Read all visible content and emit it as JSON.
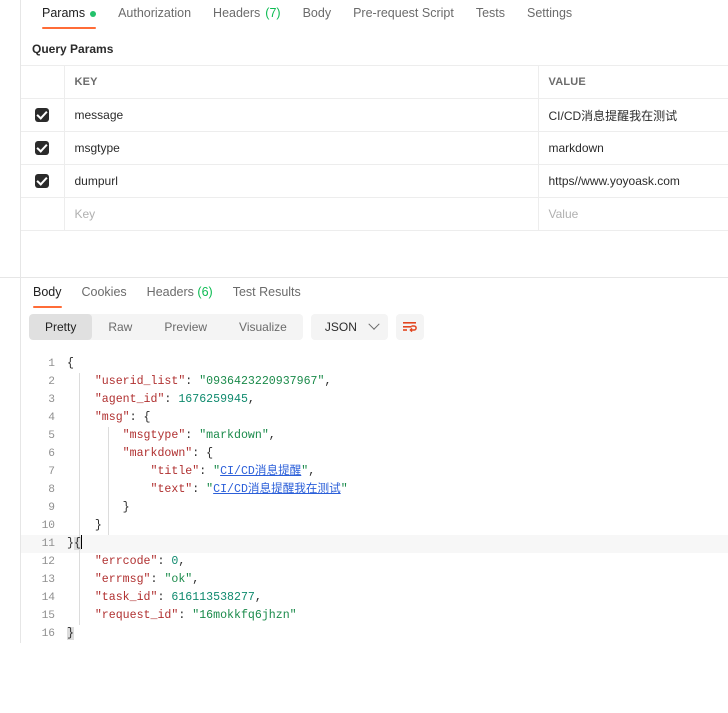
{
  "request": {
    "tabs": [
      {
        "label": "Params",
        "active": true,
        "indicator": "dot"
      },
      {
        "label": "Authorization",
        "active": false,
        "indicator": "none"
      },
      {
        "label": "Headers",
        "active": false,
        "indicator": "count",
        "count": "(7)"
      },
      {
        "label": "Body",
        "active": false,
        "indicator": "none"
      },
      {
        "label": "Pre-request Script",
        "active": false,
        "indicator": "none"
      },
      {
        "label": "Tests",
        "active": false,
        "indicator": "none"
      },
      {
        "label": "Settings",
        "active": false,
        "indicator": "none"
      }
    ],
    "section_title": "Query Params",
    "table": {
      "headers": {
        "key": "KEY",
        "value": "VALUE"
      },
      "rows": [
        {
          "checked": true,
          "key": "message",
          "value": "CI/CD消息提醒我在测试",
          "placeholder": false
        },
        {
          "checked": true,
          "key": "msgtype",
          "value": "markdown",
          "placeholder": false
        },
        {
          "checked": true,
          "key": "dumpurl",
          "value": "https//www.yoyoask.com",
          "placeholder": false
        },
        {
          "checked": false,
          "key": "Key",
          "value": "Value",
          "placeholder": true
        }
      ]
    }
  },
  "response": {
    "tabs": [
      {
        "label": "Body",
        "active": true,
        "indicator": "none"
      },
      {
        "label": "Cookies",
        "active": false,
        "indicator": "none"
      },
      {
        "label": "Headers",
        "active": false,
        "indicator": "count",
        "count": "(6)"
      },
      {
        "label": "Test Results",
        "active": false,
        "indicator": "none"
      }
    ],
    "view_modes": [
      {
        "label": "Pretty",
        "active": true
      },
      {
        "label": "Raw",
        "active": false
      },
      {
        "label": "Preview",
        "active": false
      },
      {
        "label": "Visualize",
        "active": false
      }
    ],
    "format": "JSON",
    "wrap_icon": "word-wrap-icon",
    "body_lines": [
      {
        "no": "1",
        "text": "{"
      },
      {
        "no": "2",
        "text": "    \"userid_list\": \"0936423220937967\","
      },
      {
        "no": "3",
        "text": "    \"agent_id\": 1676259945,"
      },
      {
        "no": "4",
        "text": "    \"msg\": {"
      },
      {
        "no": "5",
        "text": "        \"msgtype\": \"markdown\","
      },
      {
        "no": "6",
        "text": "        \"markdown\": {"
      },
      {
        "no": "7",
        "text": "            \"title\": \"CI/CD消息提醒\","
      },
      {
        "no": "8",
        "text": "            \"text\": \"CI/CD消息提醒我在测试\""
      },
      {
        "no": "9",
        "text": "        }"
      },
      {
        "no": "10",
        "text": "    }"
      },
      {
        "no": "11",
        "text": "}{"
      },
      {
        "no": "12",
        "text": "    \"errcode\": 0,"
      },
      {
        "no": "13",
        "text": "    \"errmsg\": \"ok\","
      },
      {
        "no": "14",
        "text": "    \"task_id\": 616113538277,"
      },
      {
        "no": "15",
        "text": "    \"request_id\": \"16mokkfq6jhzn\""
      },
      {
        "no": "16",
        "text": "}"
      }
    ]
  },
  "colors": {
    "accent": "#ff6c37",
    "status_green": "#23c16b",
    "count_green": "#0cbb52",
    "json_key": "#b03030",
    "json_string": "#1a8a4a",
    "json_number": "#0f8a6e",
    "link": "#2b5fd9"
  }
}
